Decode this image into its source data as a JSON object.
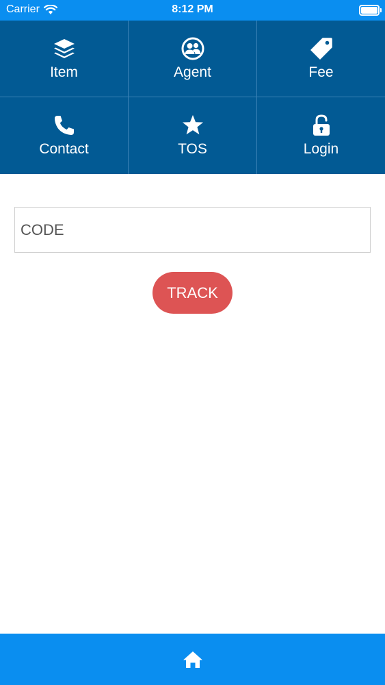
{
  "status_bar": {
    "carrier": "Carrier",
    "time": "8:12 PM"
  },
  "menu": {
    "items": [
      {
        "label": "Item",
        "icon": "layers-icon"
      },
      {
        "label": "Agent",
        "icon": "agent-icon"
      },
      {
        "label": "Fee",
        "icon": "tag-icon"
      },
      {
        "label": "Contact",
        "icon": "phone-icon"
      },
      {
        "label": "TOS",
        "icon": "star-icon"
      },
      {
        "label": "Login",
        "icon": "unlock-icon"
      }
    ]
  },
  "track_form": {
    "code_placeholder": "CODE",
    "code_value": "",
    "track_label": "TRACK"
  },
  "bottom_bar": {
    "icon": "home-icon"
  },
  "colors": {
    "status_bar": "#0a8ef0",
    "menu_background": "#025a94",
    "track_button": "#dd5454",
    "bottom_bar": "#0a8ef0"
  }
}
